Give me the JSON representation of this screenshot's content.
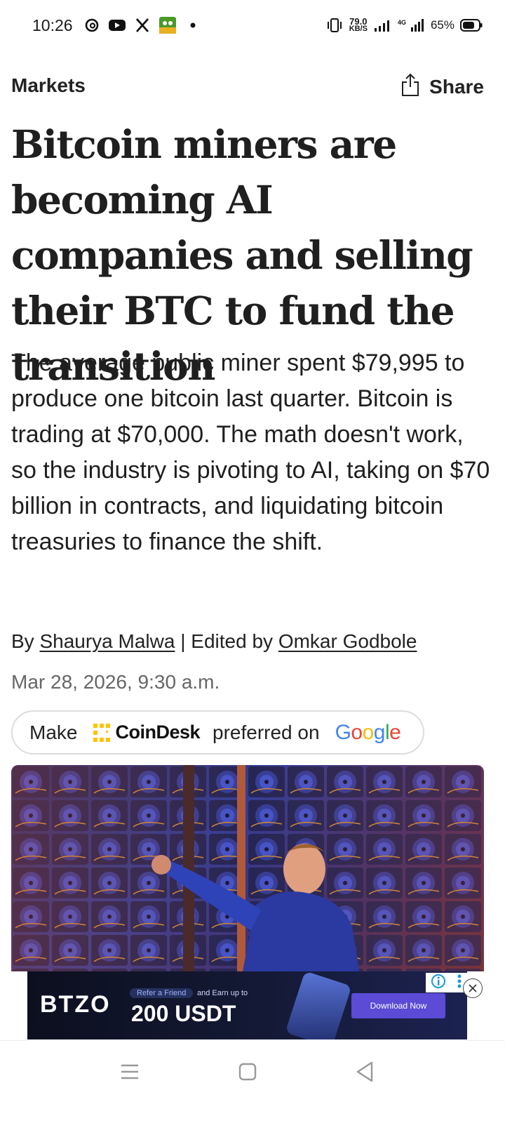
{
  "status_bar": {
    "time": "10:26",
    "app_icons": [
      "threads-icon",
      "youtube-icon",
      "x-icon",
      "game-icon",
      "dot"
    ],
    "net_speed_value": "79.0",
    "net_speed_unit": "KB/S",
    "network_type": "4G",
    "battery_percent": "65%"
  },
  "header": {
    "section": "Markets",
    "share_label": "Share"
  },
  "article": {
    "headline": "Bitcoin miners are becoming AI companies and selling their BTC to fund the transition",
    "dek": "The average public miner spent $79,995 to produce one bitcoin last quarter. Bitcoin is trading at $70,000. The math doesn't work, so the industry is pivoting to AI, taking on $70 billion in contracts, and liquidating bitcoin treasuries to finance the shift.",
    "byline_prefix": "By",
    "author": "Shaurya Malwa",
    "edited_prefix": "| Edited by",
    "editor": "Omkar Godbole",
    "date": "Mar 28, 2026, 9:30 a.m."
  },
  "preferred_source": {
    "prefix": "Make",
    "brand": "CoinDesk",
    "middle": "preferred on",
    "google": [
      "G",
      "o",
      "o",
      "g",
      "l",
      "e"
    ]
  },
  "ad": {
    "brand": "BTZO",
    "refer": "Refer a Friend",
    "earn": "and Earn up to",
    "amount": "200 USDT",
    "cta": "Download Now"
  },
  "colors": {
    "text": "#1f1f1f",
    "muted": "#666666",
    "coindesk_yellow": "#FFC200",
    "ad_cta": "#5b4bd6"
  }
}
